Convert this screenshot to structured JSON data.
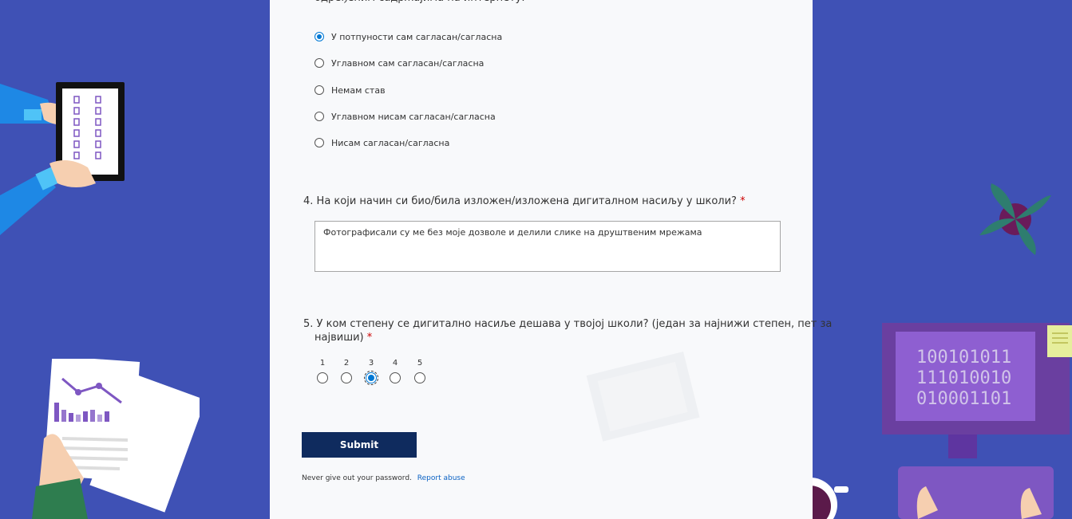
{
  "question3": {
    "title_tail": "одређеним садржајима на интернету.",
    "options": [
      {
        "label": "У потпуности сам сагласан/сагласна",
        "selected": true
      },
      {
        "label": "Углавном сам сагласан/сагласна",
        "selected": false
      },
      {
        "label": "Немам став",
        "selected": false
      },
      {
        "label": "Углавном нисам сагласан/сагласна",
        "selected": false
      },
      {
        "label": "Нисам сагласан/сагласна",
        "selected": false
      }
    ]
  },
  "question4": {
    "number": "4.",
    "title": "На који начин си био/била изложен/изложена дигиталном насиљу у школи?",
    "required_mark": "*",
    "answer": "Фотографисали су ме без моје дозволе и делили слике на друштвеним мрежама"
  },
  "question5": {
    "number": "5.",
    "title_line1": "У ком степену се дигитално насиље дешава у твојој школи? (један за најнижи степен, пет за",
    "title_line2": "највиши)",
    "required_mark": "*",
    "scale": [
      "1",
      "2",
      "3",
      "4",
      "5"
    ],
    "selected": "3"
  },
  "submit_label": "Submit",
  "footer": {
    "text": "Never give out your password.",
    "link": "Report abuse"
  },
  "colors": {
    "background": "#3f51b5",
    "panel": "#f8f9fb",
    "accent": "#0078d4",
    "submit": "#0f2b5e"
  },
  "decorations": {
    "left_tablet_text": "10010101",
    "right_monitor_lines": [
      "100101011",
      "111010010",
      "010001101"
    ]
  }
}
